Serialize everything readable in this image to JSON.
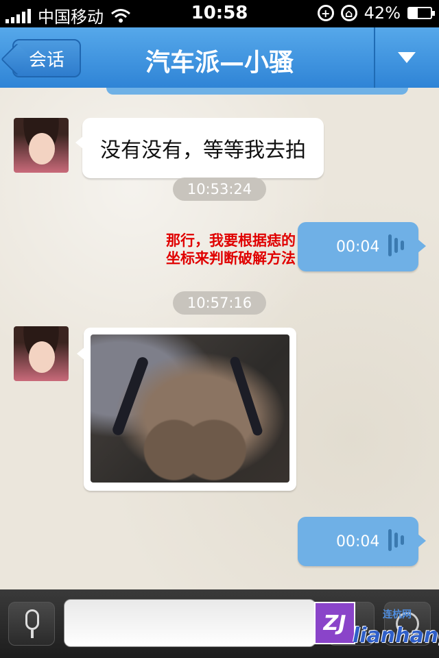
{
  "status_bar": {
    "carrier": "中国移动",
    "time": "10:58",
    "battery": "42%",
    "battery_level": 0.42
  },
  "nav": {
    "back_label": "会话",
    "title": "汽车派—小骚"
  },
  "messages": [
    {
      "type": "text",
      "direction": "incoming",
      "text": "没有没有，等等我去拍"
    },
    {
      "type": "timestamp",
      "text": "10:53:24"
    },
    {
      "type": "voice",
      "direction": "outgoing",
      "duration": "00:04"
    },
    {
      "type": "timestamp",
      "text": "10:57:16"
    },
    {
      "type": "image",
      "direction": "incoming"
    },
    {
      "type": "voice",
      "direction": "outgoing",
      "duration": "00:04"
    }
  ],
  "annotation": {
    "line1": "那行，我要根据痣的",
    "line2": "坐标来判断破解方法"
  },
  "watermark": {
    "logo": "ZJ",
    "text": "lianhang",
    "small": "连杭网"
  },
  "icons": {
    "wifi": "wifi-icon",
    "lock": "rotation-lock-icon",
    "alarm": "location-icon",
    "mic": "mic-icon",
    "emoji": "emoji-icon",
    "menu": "chevron-down-icon"
  }
}
